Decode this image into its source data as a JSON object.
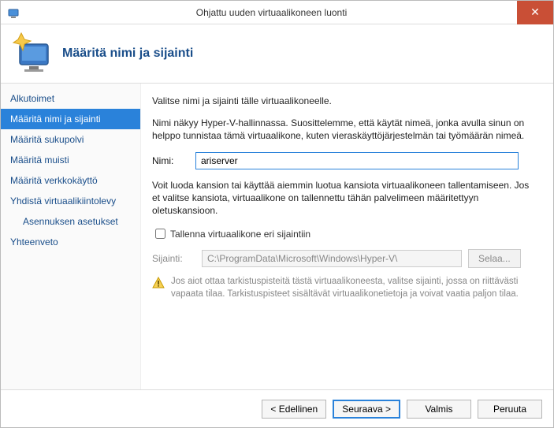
{
  "titlebar": {
    "title": "Ohjattu uuden virtuaalikoneen luonti",
    "close_glyph": "✕"
  },
  "header": {
    "title": "Määritä nimi ja sijainti"
  },
  "sidebar": {
    "items": [
      {
        "label": "Alkutoimet",
        "selected": false
      },
      {
        "label": "Määritä nimi ja sijainti",
        "selected": true
      },
      {
        "label": "Määritä sukupolvi",
        "selected": false
      },
      {
        "label": "Määritä muisti",
        "selected": false
      },
      {
        "label": "Määritä verkkokäyttö",
        "selected": false
      },
      {
        "label": "Yhdistä virtuaalikiintolevy",
        "selected": false
      },
      {
        "label": "Asennuksen asetukset",
        "selected": false,
        "sub": true
      },
      {
        "label": "Yhteenveto",
        "selected": false
      }
    ]
  },
  "content": {
    "intro": "Valitse nimi ja sijainti tälle virtuaalikoneelle.",
    "desc": "Nimi näkyy Hyper-V-hallinnassa. Suosittelemme, että käytät nimeä, jonka avulla sinun on helppo tunnistaa tämä virtuaalikone, kuten vieraskäyttöjärjestelmän tai työmäärän nimeä.",
    "name_label": "Nimi:",
    "name_value": "ariserver",
    "folder_hint": "Voit luoda kansion tai käyttää aiemmin luotua kansiota virtuaalikoneen tallentamiseen. Jos et valitse kansiota, virtuaalikone on tallennettu tähän palvelimeen määritettyyn oletuskansioon.",
    "store_checkbox_label": "Tallenna virtuaalikone eri sijaintiin",
    "location_label": "Sijainti:",
    "location_value": "C:\\ProgramData\\Microsoft\\Windows\\Hyper-V\\",
    "browse_label": "Selaa...",
    "warning_text": "Jos aiot ottaa tarkistuspisteitä tästä virtuaalikoneesta, valitse sijainti, jossa on riittävästi vapaata tilaa. Tarkistuspisteet sisältävät virtuaalikonetietoja ja voivat vaatia paljon tilaa."
  },
  "footer": {
    "back": "< Edellinen",
    "next": "Seuraava >",
    "finish": "Valmis",
    "cancel": "Peruuta"
  }
}
